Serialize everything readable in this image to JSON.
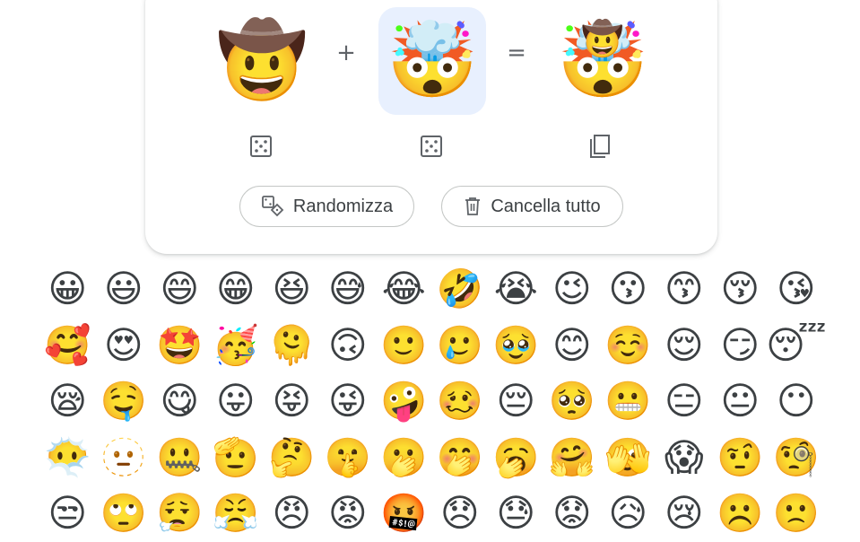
{
  "kitchen": {
    "left_emoji": "🤠",
    "plus": "+",
    "middle_emoji": "🤯",
    "equals": "=",
    "result_emoji": "🤯",
    "result_hat": "🤠"
  },
  "buttons": {
    "randomize_label": "Randomizza",
    "clear_label": "Cancella tutto"
  },
  "icons": {
    "left_control": "dice-icon",
    "middle_control": "dice-icon",
    "right_control": "copy-icon",
    "randomize": "dice-shapes-icon",
    "clear": "trash-icon"
  },
  "colors": {
    "selected_slot_bg": "#e8f0fe",
    "pill_border": "#c4c7c5",
    "icon_gray": "#5f6368"
  },
  "emoji_grid": [
    "😀",
    "😃",
    "😄",
    "😁",
    "😆",
    "😅",
    "😂",
    "🤣",
    "😭",
    "😉",
    "😗",
    "😙",
    "😚",
    "😘",
    "🥰",
    "😍",
    "🤩",
    "🥳",
    "🫠",
    "🙃",
    "🙂",
    "🥲",
    "🥹",
    "😊",
    "☺️",
    "😌",
    "😏",
    "😴",
    "😪",
    "🤤",
    "😋",
    "😛",
    "😝",
    "😜",
    "🤪",
    "🥴",
    "😔",
    "🥺",
    "😬",
    "😑",
    "😐",
    "😶",
    "😶‍🌫️",
    "🫥",
    "🤐",
    "🫡",
    "🤔",
    "🤫",
    "🫢",
    "🤭",
    "🥱",
    "🤗",
    "🫣",
    "😱",
    "🤨",
    "🧐",
    "😒",
    "🙄",
    "😮‍💨",
    "😤",
    "😠",
    "😡",
    "🤬",
    "😞",
    "😓",
    "😟",
    "😥",
    "😢",
    "☹️",
    "🙁"
  ]
}
